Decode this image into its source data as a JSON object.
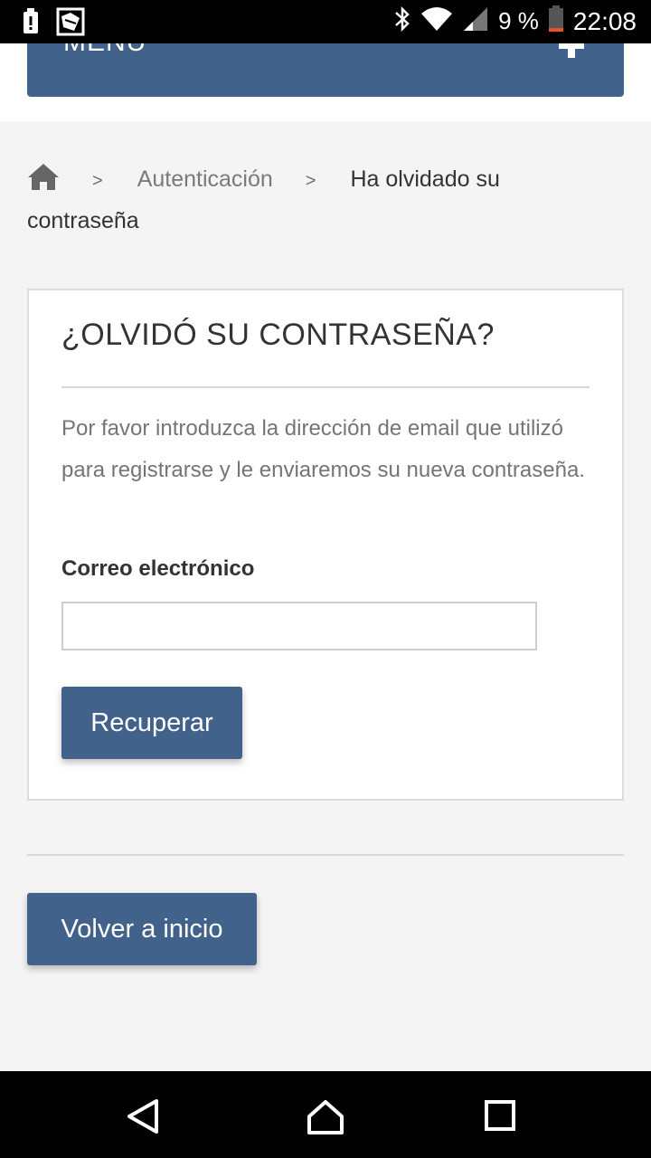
{
  "status_bar": {
    "battery_percent": "9 %",
    "time": "22:08",
    "icons": [
      "alert-battery-icon",
      "app-notification-icon",
      "bluetooth-icon",
      "wifi-icon",
      "signal-icon",
      "battery-icon"
    ]
  },
  "menu": {
    "label": "MENÚ",
    "expand_icon": "plus-icon"
  },
  "breadcrumb": {
    "home_icon": "home-icon",
    "separator": ">",
    "link_label": "Autenticación",
    "current_label": "Ha olvidado su contraseña"
  },
  "panel": {
    "title": "¿OLVIDÓ SU CONTRASEÑA?",
    "description": "Por favor introduzca la dirección de email que utilizó para registrarse y le enviaremos su nueva contraseña.",
    "email_label": "Correo electrónico",
    "email_value": "",
    "recover_button": "Recuperar"
  },
  "back_button": "Volver a inicio",
  "nav_bar": {
    "icons": [
      "back-triangle-icon",
      "home-circle-icon",
      "recents-square-icon"
    ]
  },
  "colors": {
    "primary": "#41628a",
    "background": "#f4f4f4"
  }
}
